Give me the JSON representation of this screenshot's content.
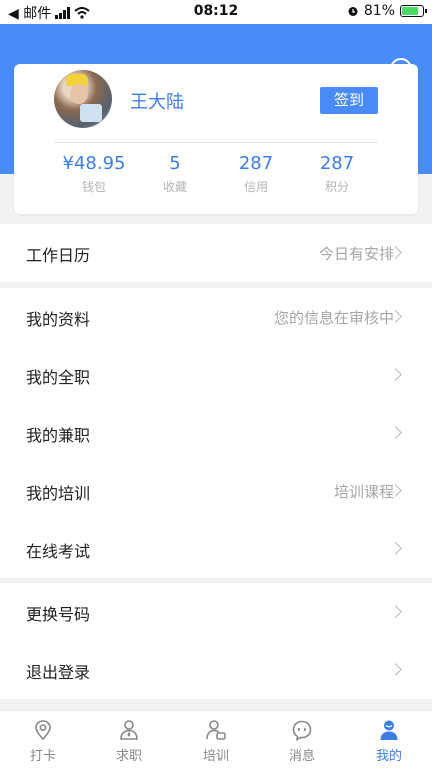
{
  "status_bar": {
    "back_label": "◀ 邮件",
    "time": "08:12",
    "battery": "81%"
  },
  "profile": {
    "name": "王大陆",
    "signin_label": "签到",
    "stats": [
      {
        "value": "¥48.95",
        "label": "钱包"
      },
      {
        "value": "5",
        "label": "收藏"
      },
      {
        "value": "287",
        "label": "信用"
      },
      {
        "value": "287",
        "label": "积分"
      }
    ]
  },
  "calendar": {
    "label": "工作日历",
    "value": "今日有安排"
  },
  "menu": [
    {
      "label": "我的资料",
      "value": "您的信息在审核中"
    },
    {
      "label": "我的全职",
      "value": ""
    },
    {
      "label": "我的兼职",
      "value": ""
    },
    {
      "label": "我的培训",
      "value": "培训课程"
    },
    {
      "label": "在线考试",
      "value": ""
    }
  ],
  "account": [
    {
      "label": "更换号码",
      "value": ""
    },
    {
      "label": "退出登录",
      "value": ""
    }
  ],
  "tabs": [
    {
      "label": "打卡",
      "icon": "location-pin-icon"
    },
    {
      "label": "求职",
      "icon": "briefcase-person-icon"
    },
    {
      "label": "培训",
      "icon": "trainee-icon"
    },
    {
      "label": "消息",
      "icon": "message-icon"
    },
    {
      "label": "我的",
      "icon": "user-icon"
    }
  ],
  "colors": {
    "accent": "#4a8cf7",
    "active_tab": "#3d7de6",
    "muted": "#a6a6a6"
  }
}
